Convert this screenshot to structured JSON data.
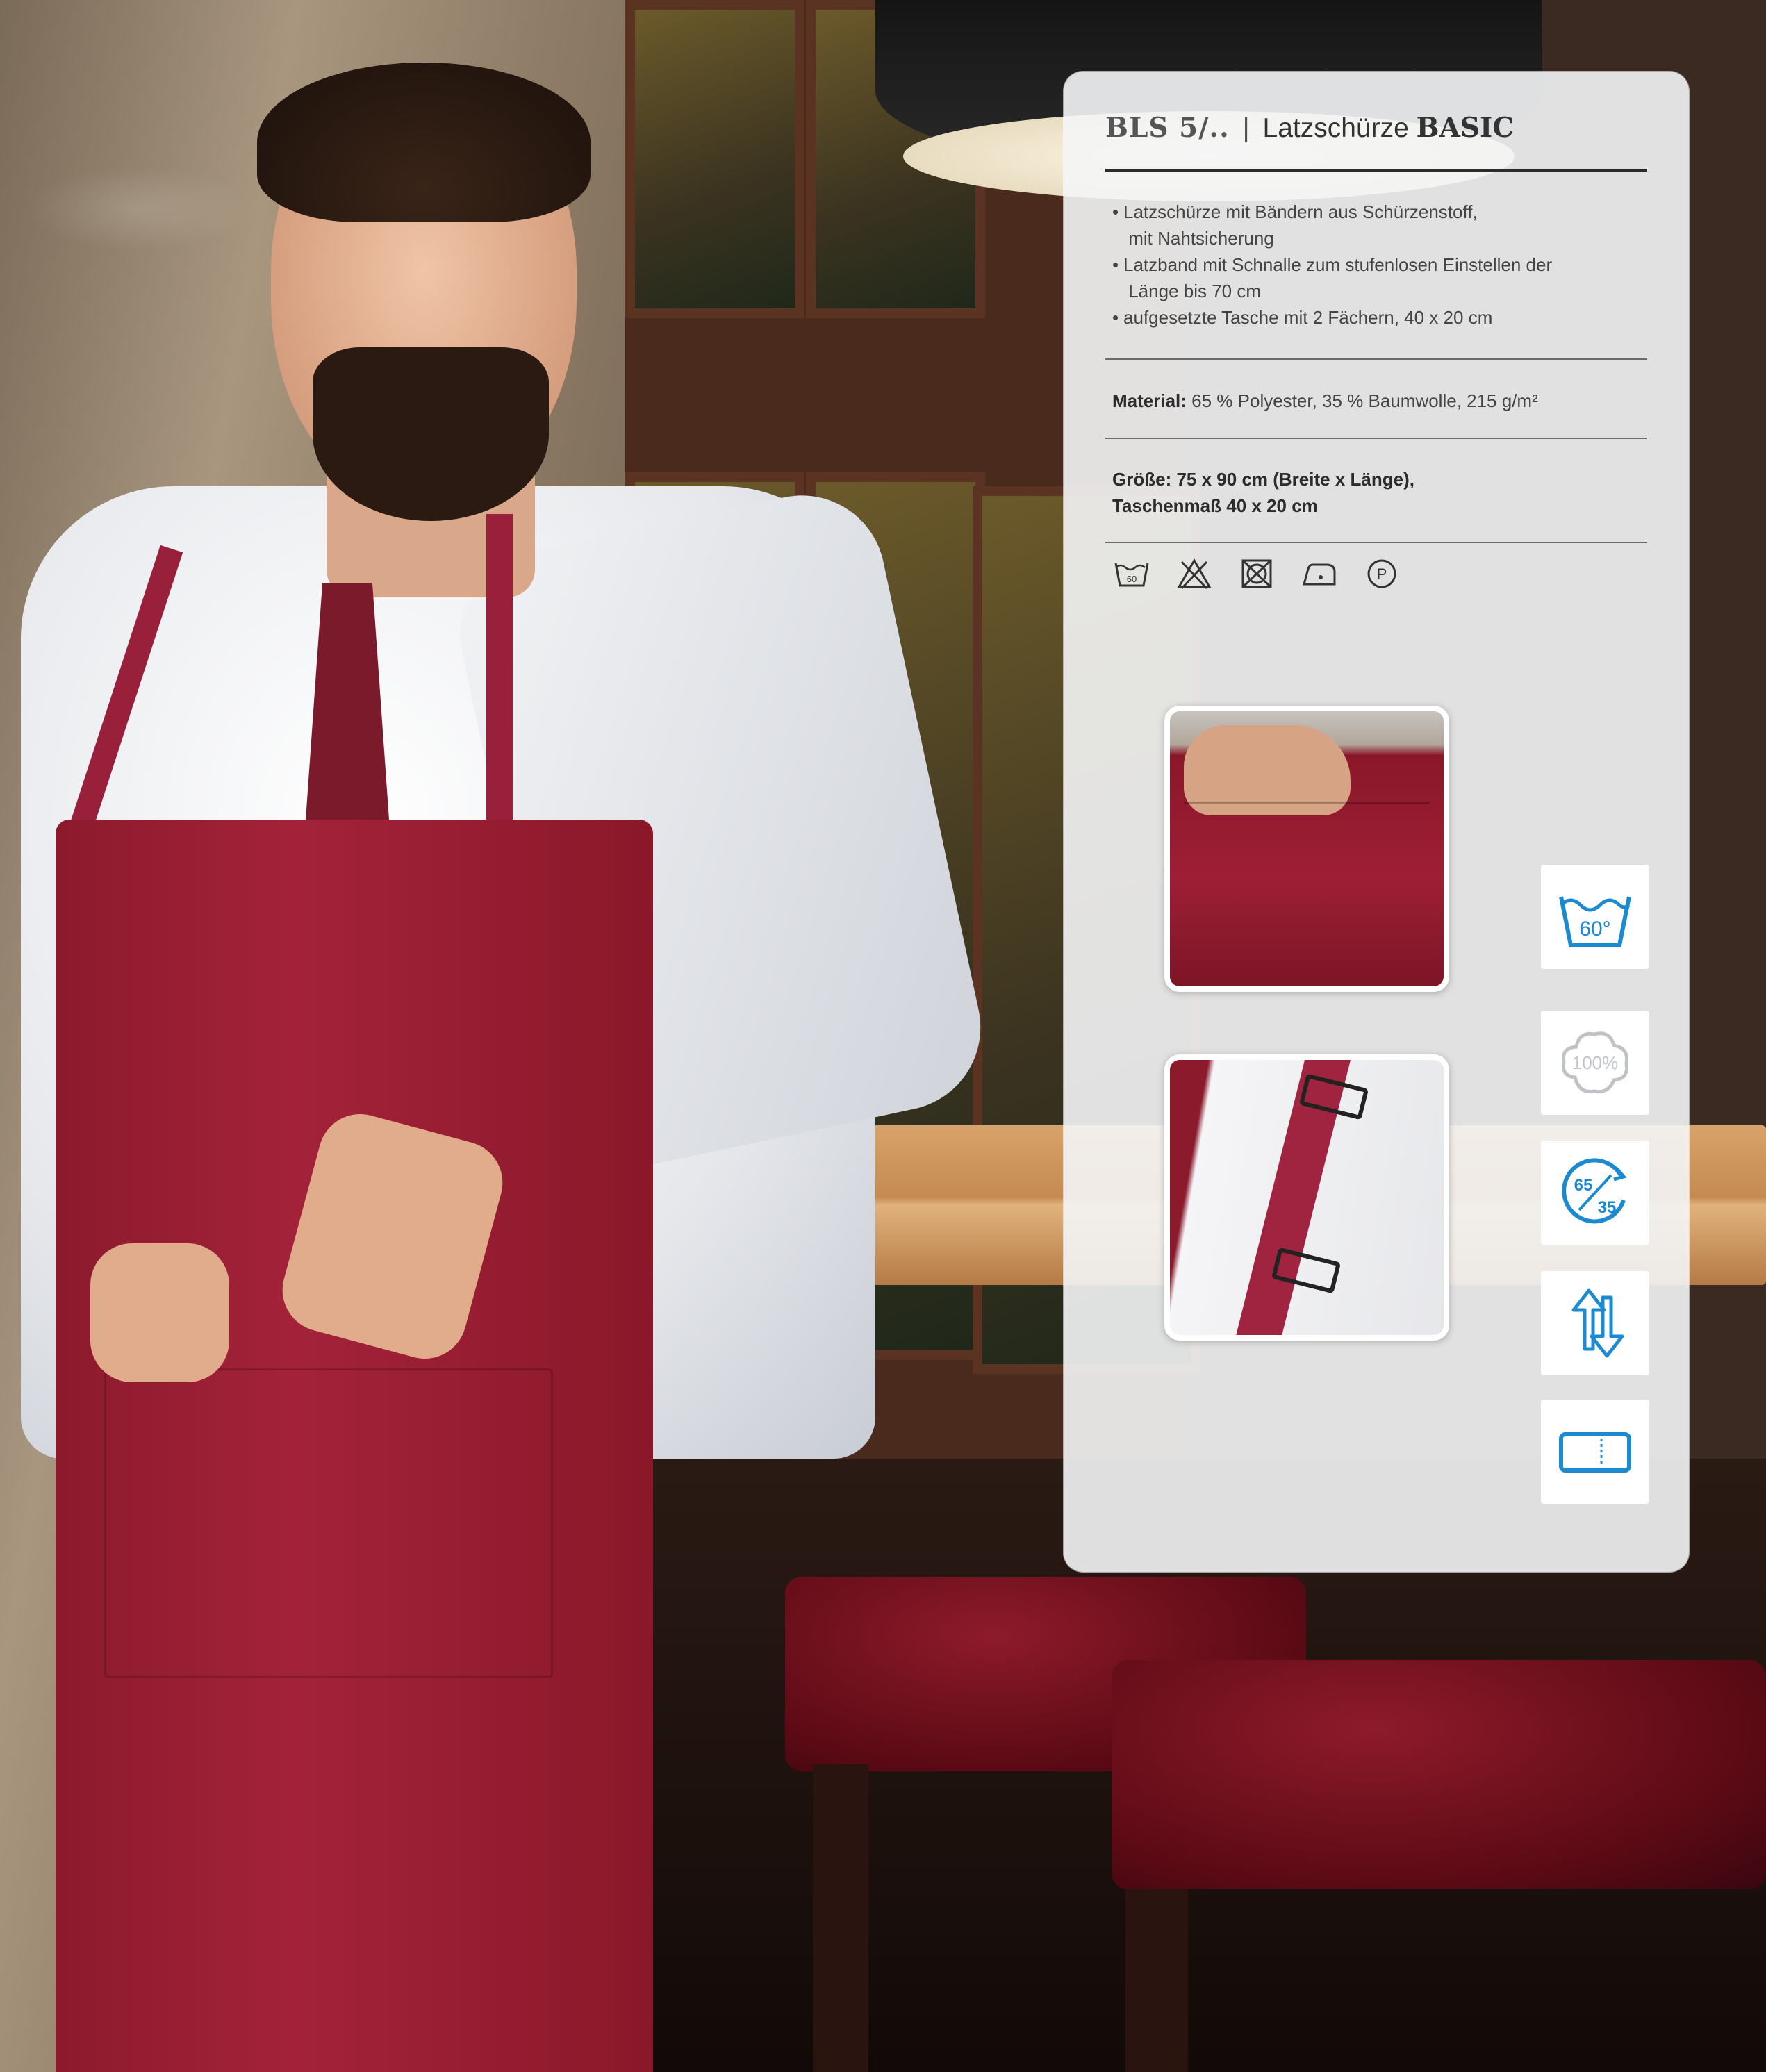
{
  "product": {
    "code": "BLS 5/..",
    "separator": "|",
    "name": "Latzschürze",
    "line": "BASIC"
  },
  "features": [
    "Latzschürze mit Bändern aus Schürzenstoff,\n mit Nahtsicherung",
    "Latzband mit Schnalle zum stufenlosen Einstellen der\n Länge bis 70 cm",
    "aufgesetzte Tasche mit 2 Fächern, 40 x 20 cm"
  ],
  "material": {
    "label": "Material:",
    "value": "65 % Polyester, 35 % Baumwolle, 215 g/m²"
  },
  "size": {
    "label": "Größe:",
    "line1": "75 x 90 cm (Breite x Länge),",
    "line2": "Taschenmaß 40 x 20 cm"
  },
  "care_symbols": [
    "wash-60-icon",
    "no-bleach-icon",
    "no-tumble-dry-icon",
    "iron-icon",
    "dry-clean-p-icon"
  ],
  "care_wash_temp": "60",
  "care_dryclean_letter": "P",
  "badges": {
    "wash": "60°",
    "cotton": "100%",
    "blend_top": "65",
    "blend_bottom": "35"
  },
  "colors": {
    "accent_blue": "#1c8ad0",
    "apron_red": "#9b1f35",
    "panel_bg": "#f4f5f6"
  }
}
